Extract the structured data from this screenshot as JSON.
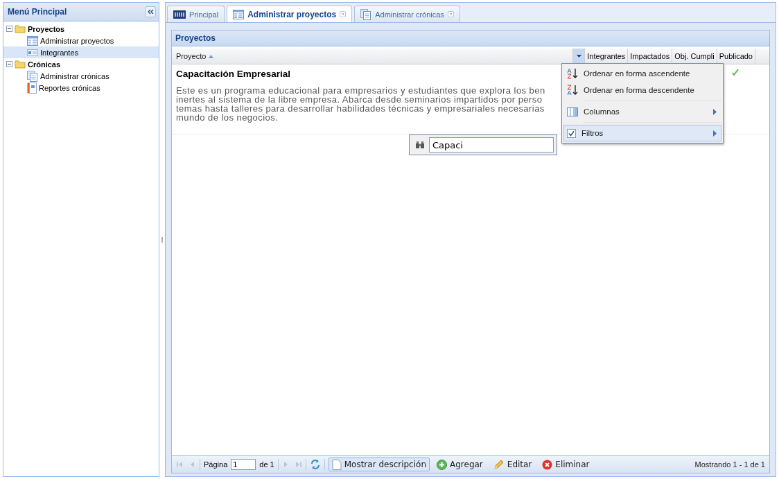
{
  "sidebar": {
    "title": "Menú Principal",
    "tree": [
      {
        "label": "Proyectos",
        "kind": "folder",
        "expanded": true,
        "selected": false,
        "children": [
          {
            "label": "Administrar proyectos",
            "kind": "grid",
            "selected": false
          },
          {
            "label": "Integrantes",
            "kind": "card",
            "selected": true
          }
        ]
      },
      {
        "label": "Crónicas",
        "kind": "folder",
        "expanded": true,
        "selected": false,
        "children": [
          {
            "label": "Administrar crónicas",
            "kind": "docs",
            "selected": false
          },
          {
            "label": "Reportes crónicas",
            "kind": "report",
            "selected": false
          }
        ]
      }
    ]
  },
  "tabs": [
    {
      "label": "Principal",
      "kind": "logo",
      "selected": false,
      "closable": false
    },
    {
      "label": "Administrar proyectos",
      "kind": "grid",
      "selected": true,
      "closable": true
    },
    {
      "label": "Administrar crónicas",
      "kind": "docs",
      "selected": false,
      "closable": true
    }
  ],
  "panel": {
    "title": "Proyectos"
  },
  "table": {
    "columns": [
      {
        "label": "Proyecto",
        "sorted": true
      },
      {
        "label": "Integrantes",
        "sorted": false
      },
      {
        "label": "Impactados",
        "sorted": false
      },
      {
        "label": "Obj. Cumpli",
        "sorted": false
      },
      {
        "label": "Publicado",
        "sorted": false
      }
    ],
    "rows": [
      {
        "title": "Capacitación Empresarial",
        "description": [
          "Este es un programa educacional para empresarios y estudiantes que explora los ben",
          "inertes al sistema de la libre empresa. Abarca desde seminarios impartidos por perso",
          "temas hasta talleres para desarrollar habilidades técnicas y empresariales necesarias",
          "mundo de los negocios."
        ],
        "published": true
      }
    ]
  },
  "column_menu": {
    "items": [
      {
        "kind": "sort-asc",
        "label": "Ordenar en forma ascendente",
        "highlighted": false
      },
      {
        "kind": "sort-desc",
        "label": "Ordenar en forma descendente",
        "highlighted": false
      },
      {
        "kind": "columns",
        "label": "Columnas",
        "highlighted": false
      },
      {
        "kind": "filter",
        "label": "Filtros",
        "checked": true,
        "highlighted": true
      }
    ]
  },
  "filter_field": {
    "value": "Capaci"
  },
  "paging": {
    "page_label": "Página",
    "page": "1",
    "of_label": "de 1",
    "display": "Mostrando 1 - 1 de 1"
  },
  "actions": [
    {
      "kind": "toggle",
      "label": "Mostrar descripción",
      "pressed": true
    },
    {
      "kind": "add",
      "label": "Agregar"
    },
    {
      "kind": "edit",
      "label": "Editar"
    },
    {
      "kind": "delete",
      "label": "Eliminar"
    }
  ]
}
